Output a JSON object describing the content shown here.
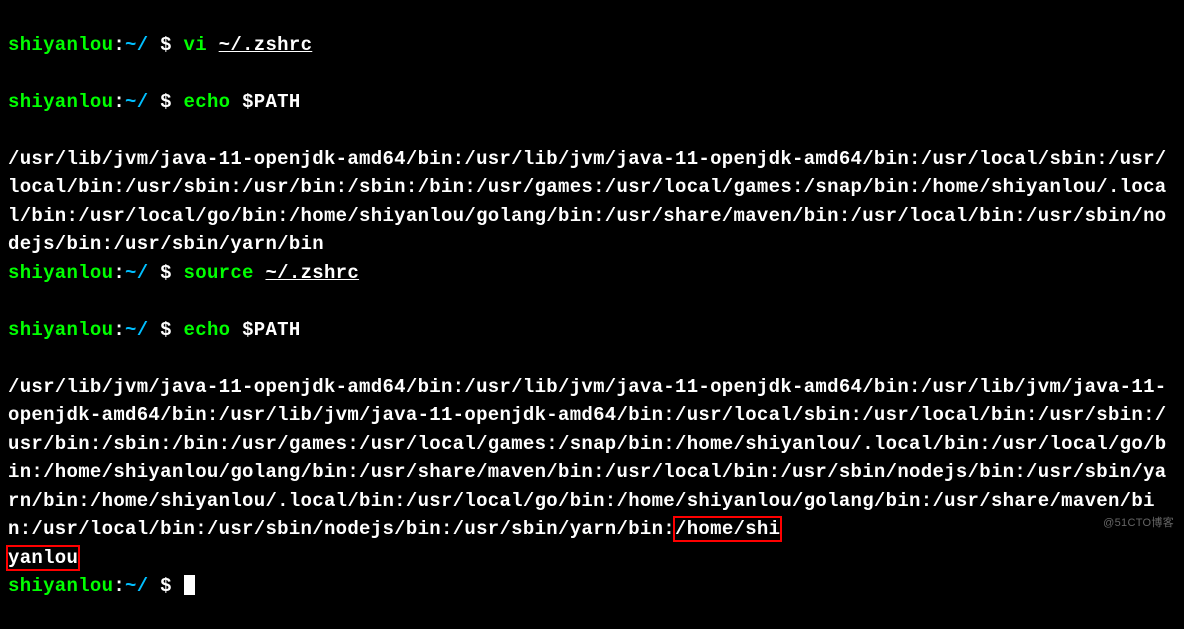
{
  "prompt": {
    "user": "shiyanlou",
    "sep": ":",
    "path": "~/",
    "dollar": " $ "
  },
  "lines": {
    "l1_cmd": "vi",
    "l1_arg": "~/.zshrc",
    "l2_cmd": "echo",
    "l2_arg": "$PATH",
    "l3_output": "/usr/lib/jvm/java-11-openjdk-amd64/bin:/usr/lib/jvm/java-11-openjdk-amd64/bin:/usr/local/sbin:/usr/local/bin:/usr/sbin:/usr/bin:/sbin:/bin:/usr/games:/usr/local/games:/snap/bin:/home/shiyanlou/.local/bin:/usr/local/go/bin:/home/shiyanlou/golang/bin:/usr/share/maven/bin:/usr/local/bin:/usr/sbin/nodejs/bin:/usr/sbin/yarn/bin",
    "l4_cmd": "source",
    "l4_arg": "~/.zshrc",
    "l5_cmd": "echo",
    "l5_arg": "$PATH",
    "l6_output_pre": "/usr/lib/jvm/java-11-openjdk-amd64/bin:/usr/lib/jvm/java-11-openjdk-amd64/bin:/usr/lib/jvm/java-11-openjdk-amd64/bin:/usr/lib/jvm/java-11-openjdk-amd64/bin:/usr/local/sbin:/usr/local/bin:/usr/sbin:/usr/bin:/sbin:/bin:/usr/games:/usr/local/games:/snap/bin:/home/shiyanlou/.local/bin:/usr/local/go/bin:/home/shiyanlou/golang/bin:/usr/share/maven/bin:/usr/local/bin:/usr/sbin/nodejs/bin:/usr/sbin/yarn/bin:/home/shiyanlou/.local/bin:/usr/local/go/bin:/home/shiyanlou/golang/bin:/usr/share/maven/bin:/usr/local/bin:/usr/sbin/nodejs/bin:/usr/sbin/yarn/bin:",
    "l6_output_hl1": "/home/shi",
    "l6_output_hl2": "yanlou"
  },
  "watermark": "@51CTO博客"
}
